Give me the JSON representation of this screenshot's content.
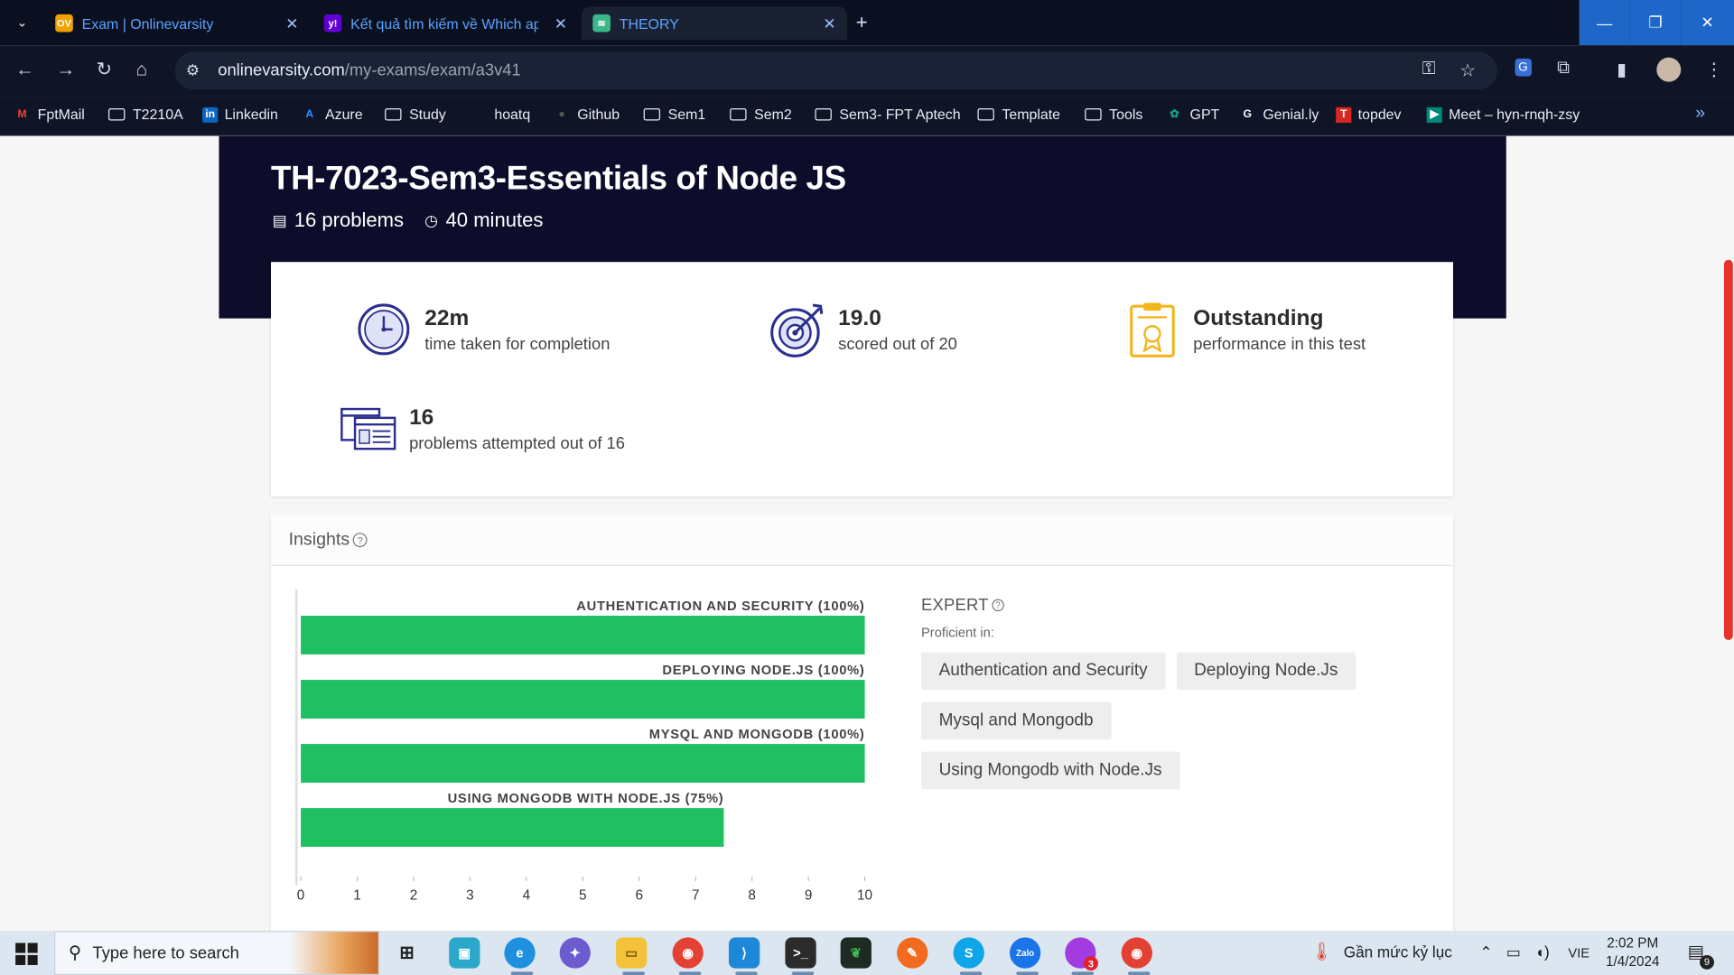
{
  "browser": {
    "tabs": [
      {
        "title": "Exam | Onlinevarsity",
        "favicon": "OV"
      },
      {
        "title": "Kết quả tìm kiếm về Which app",
        "favicon": "y!"
      },
      {
        "title": "THEORY",
        "favicon": "≋"
      }
    ],
    "url_host": "onlinevarsity.com",
    "url_path": "/my-exams/exam/a3v41",
    "bookmarks": [
      {
        "label": "FptMail",
        "icon": "gmail"
      },
      {
        "label": "T2210A",
        "icon": "folder"
      },
      {
        "label": "Linkedin",
        "icon": "linkedin"
      },
      {
        "label": "Azure",
        "icon": "azure"
      },
      {
        "label": "Study",
        "icon": "folder"
      },
      {
        "label": "hoatq",
        "icon": "none"
      },
      {
        "label": "Github",
        "icon": "github"
      },
      {
        "label": "Sem1",
        "icon": "folder"
      },
      {
        "label": "Sem2",
        "icon": "folder"
      },
      {
        "label": "Sem3- FPT Aptech",
        "icon": "folder"
      },
      {
        "label": "Template",
        "icon": "folder"
      },
      {
        "label": "Tools",
        "icon": "folder"
      },
      {
        "label": "GPT",
        "icon": "openai"
      },
      {
        "label": "Genial.ly",
        "icon": "genially"
      },
      {
        "label": "topdev",
        "icon": "topdev"
      },
      {
        "label": "Meet – hyn-rnqh-zsy",
        "icon": "meet"
      }
    ]
  },
  "exam": {
    "title": "TH-7023-Sem3-Essentials of Node JS",
    "problems_label": "16 problems",
    "duration_label": "40 minutes"
  },
  "stats": {
    "time": {
      "value": "22m",
      "label": "time taken for completion",
      "icon": "clock-icon"
    },
    "score": {
      "value": "19.0",
      "label": "scored out of 20",
      "icon": "target-icon"
    },
    "performance": {
      "value": "Outstanding",
      "label": "performance in this test",
      "icon": "certificate-icon"
    },
    "attempted": {
      "value": "16",
      "label": "problems attempted out of 16",
      "icon": "documents-icon"
    }
  },
  "insights": {
    "header": "Insights",
    "expert_title": "EXPERT",
    "proficient_label": "Proficient in:",
    "chips": [
      "Authentication and Security",
      "Deploying Node.Js",
      "Mysql and Mongodb",
      "Using Mongodb with Node.Js"
    ]
  },
  "chart_data": {
    "type": "bar",
    "orientation": "horizontal",
    "categories": [
      "AUTHENTICATION AND SECURITY (100%)",
      "DEPLOYING NODE.JS (100%)",
      "MYSQL AND MONGODB (100%)",
      "USING MONGODB WITH NODE.JS (75%)"
    ],
    "values": [
      10,
      10,
      10,
      7.5
    ],
    "xlim": [
      0,
      10
    ],
    "xticks": [
      "0",
      "1",
      "2",
      "3",
      "4",
      "5",
      "6",
      "7",
      "8",
      "9",
      "10"
    ],
    "bar_color": "#1fbf62",
    "grid": false
  },
  "taskbar": {
    "search_placeholder": "Type here to search",
    "weather": "Gần mức kỷ lục",
    "language": "VIE",
    "time": "2:02 PM",
    "date": "1/4/2024",
    "notification_count": "9",
    "messenger_badge": "3"
  },
  "colors": {
    "hero_bg": "#0d0d2b",
    "accent_icon": "#2b2f8f",
    "award_yellow": "#f2b51c",
    "bar_green": "#1fbf62"
  }
}
